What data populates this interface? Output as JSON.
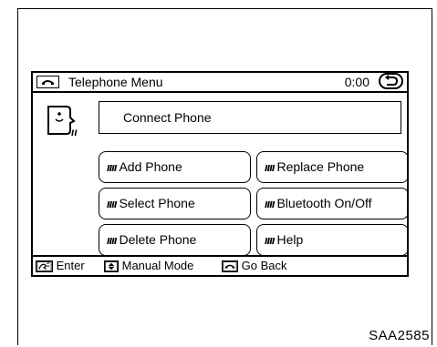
{
  "header": {
    "title": "Telephone Menu",
    "timer": "0:00"
  },
  "main": {
    "connect_label": "Connect Phone",
    "buttons": [
      {
        "label": "Add Phone"
      },
      {
        "label": "Replace Phone"
      },
      {
        "label": "Select Phone"
      },
      {
        "label": "Bluetooth On/Off"
      },
      {
        "label": "Delete Phone"
      },
      {
        "label": "Help"
      }
    ]
  },
  "statusbar": {
    "enter": "Enter",
    "manual_mode": "Manual Mode",
    "go_back": "Go Back"
  },
  "figure_code": "SAA2585",
  "icons": {
    "phone": "phone-icon",
    "back": "back-arrow-icon",
    "voice": "voice-recognition-icon",
    "talk": "talk-icon",
    "up_down": "up-down-arrow-icon"
  }
}
